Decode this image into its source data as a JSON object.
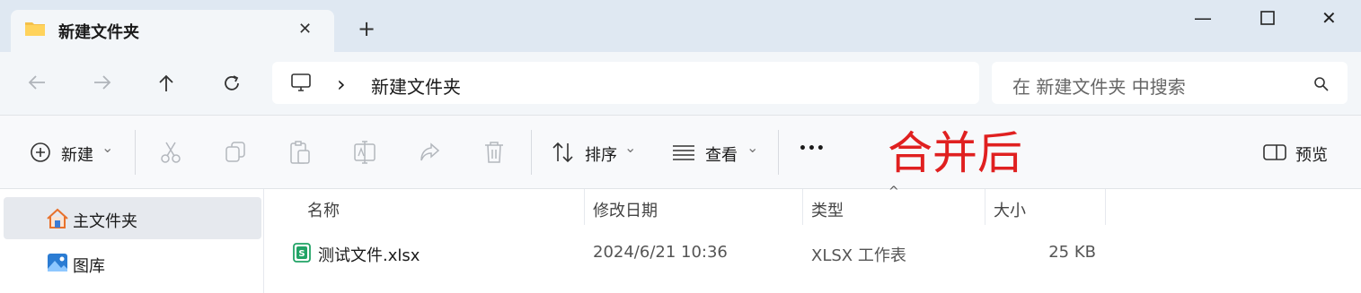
{
  "tab": {
    "title": "新建文件夹",
    "close_glyph": "✕",
    "new_glyph": "+"
  },
  "window_controls": {
    "minimize": "—",
    "maximize": "☐",
    "close": "✕"
  },
  "address": {
    "separator": "›",
    "folder": "新建文件夹"
  },
  "search": {
    "placeholder": "在 新建文件夹 中搜索"
  },
  "toolbar": {
    "new_label": "新建",
    "sort_label": "排序",
    "view_label": "查看",
    "more_label": "•••",
    "preview_label": "预览",
    "dropdown_glyph": "⌄"
  },
  "annotation": {
    "text": "合并后",
    "color": "#e02020"
  },
  "sidebar": {
    "items": [
      {
        "label": "主文件夹",
        "selected": true
      },
      {
        "label": "图库",
        "selected": false
      }
    ]
  },
  "columns": {
    "name": "名称",
    "modified": "修改日期",
    "type": "类型",
    "size": "大小",
    "sort_indicator": "^"
  },
  "files": [
    {
      "name": "测试文件.xlsx",
      "modified": "2024/6/21 10:36",
      "type": "XLSX 工作表",
      "size": "25 KB"
    }
  ],
  "colors": {
    "accent": "#1f5fa8",
    "tabbar_bg": "#dfe8f2",
    "excel_green": "#21a366"
  }
}
